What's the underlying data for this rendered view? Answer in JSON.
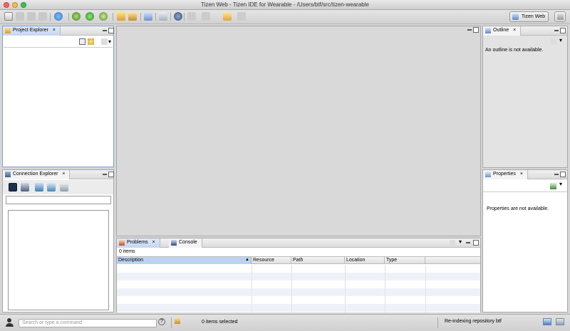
{
  "window": {
    "title": "Tizen Web - Tizen IDE for Wearable - /Users/btf/src/tizen-wearable"
  },
  "toolbar": {
    "perspective_label": "Tizen Web"
  },
  "project_explorer": {
    "tab_label": "Project Explorer"
  },
  "connection_explorer": {
    "tab_label": "Connection Explorer",
    "filter_value": ""
  },
  "outline": {
    "tab_label": "Outline",
    "message": "An outline is not available."
  },
  "properties": {
    "tab_label": "Properties",
    "message": "Properties are not available."
  },
  "bottom": {
    "tabs": [
      {
        "label": "Problems"
      },
      {
        "label": "Console"
      }
    ],
    "count": "0 items",
    "columns": [
      "Description",
      "Resource",
      "Path",
      "Location",
      "Type"
    ]
  },
  "statusbar": {
    "command_placeholder": "Search or type a command",
    "selection": "0 items selected",
    "progress": "Re-indexing repository btf"
  },
  "colors": {
    "active_tab": "#c5d6f2",
    "selected_header": "#bcd3f0",
    "panel_border": "#a9a9a9"
  }
}
